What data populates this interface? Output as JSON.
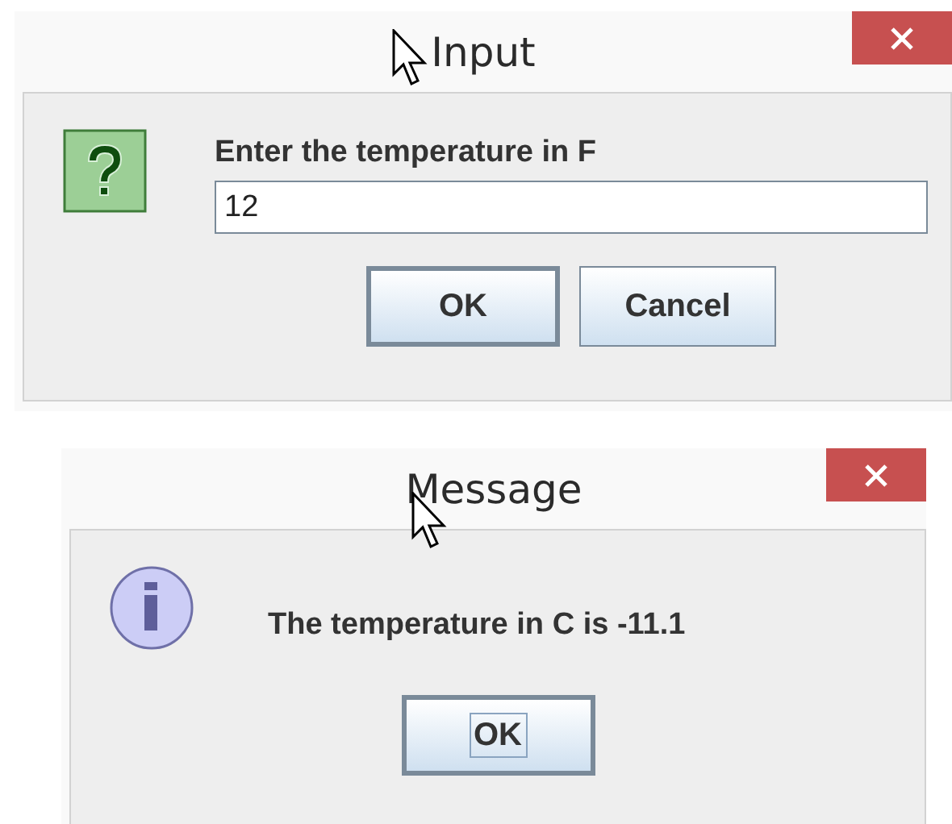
{
  "dialogs": [
    {
      "title": "Input",
      "kind": "question",
      "prompt": "Enter the temperature in F",
      "field": {
        "value": "12"
      },
      "buttons": [
        {
          "label": "OK",
          "default": true,
          "focused": false
        },
        {
          "label": "Cancel",
          "default": false,
          "focused": false
        }
      ]
    },
    {
      "title": "Message",
      "kind": "info",
      "prompt": "The temperature in C is -11.1",
      "buttons": [
        {
          "label": "OK",
          "default": true,
          "focused": true
        }
      ]
    }
  ]
}
